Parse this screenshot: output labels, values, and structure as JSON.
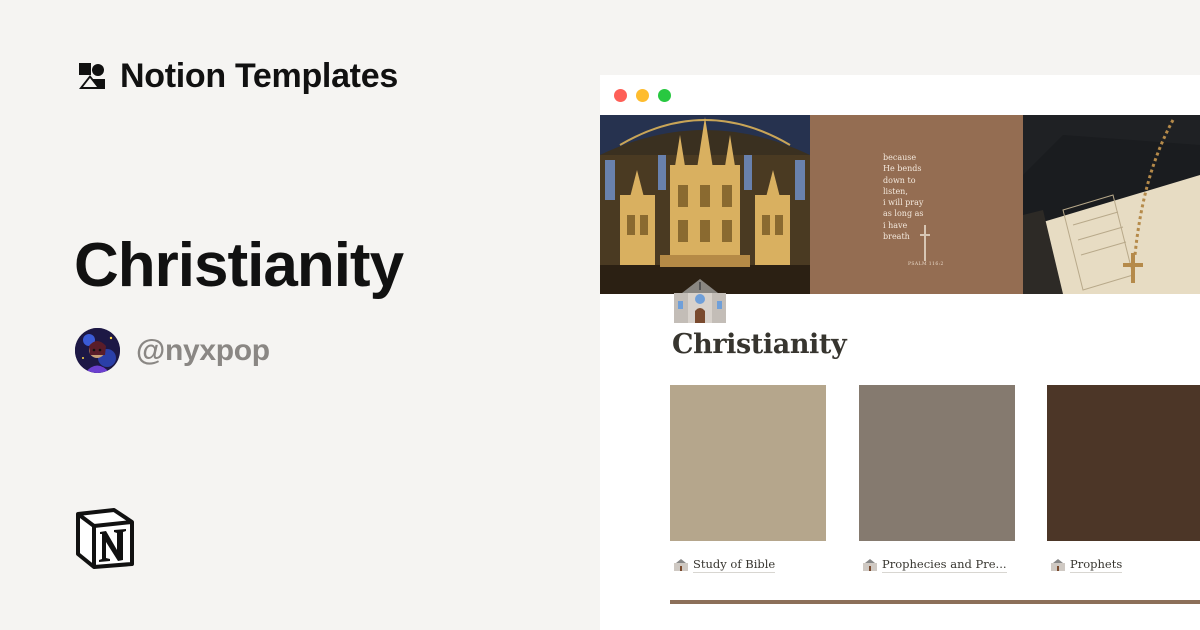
{
  "brand": {
    "name": "Notion Templates",
    "icon": "notion-templates-shapes-icon"
  },
  "template": {
    "title": "Christianity"
  },
  "author": {
    "handle": "@nyxpop",
    "avatar": "avatar-image"
  },
  "footer": {
    "logo": "notion-logo-icon"
  },
  "window": {
    "controls": [
      "close",
      "minimize",
      "maximize"
    ],
    "cover": {
      "verse_text": "because\nHe bends\ndown to\nlisten,\ni will pray\nas long as\ni have\nbreath",
      "verse_reference": "PSALM 116:2"
    },
    "page": {
      "icon": "church-icon",
      "title": "Christianity",
      "cards": [
        {
          "label": "Study of Bible",
          "color": "#b5a68c",
          "icon": "church-icon"
        },
        {
          "label": "Prophecies and Pre...",
          "color": "#857a6f",
          "icon": "church-icon"
        },
        {
          "label": "Prophets",
          "color": "#4c3627",
          "icon": "church-icon"
        }
      ]
    }
  },
  "colors": {
    "background": "#f5f4f2",
    "cover_mid": "#946d52",
    "divider": "#8c6f59"
  }
}
